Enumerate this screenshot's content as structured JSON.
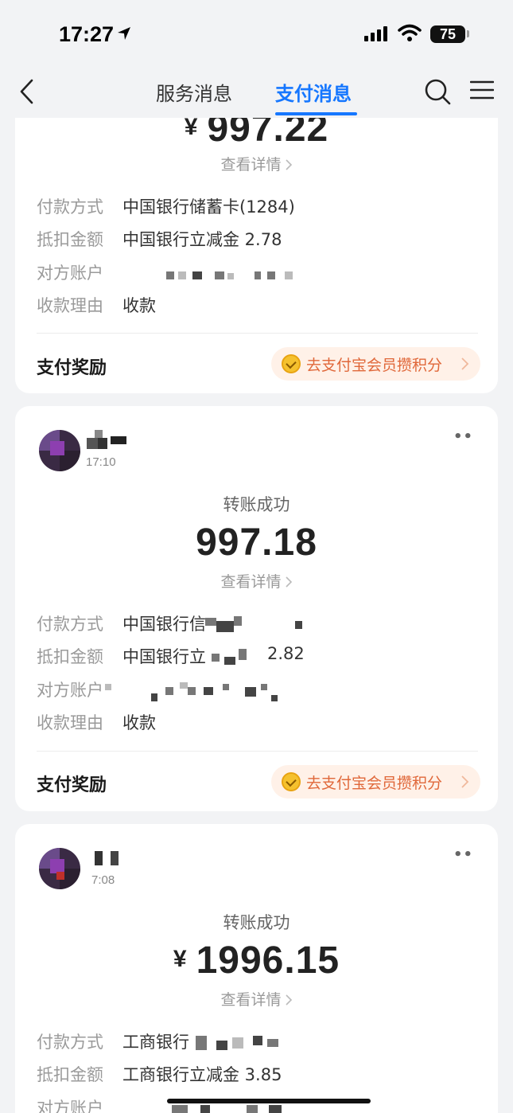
{
  "status_bar": {
    "time": "17:27",
    "battery": "75"
  },
  "nav": {
    "tabs": [
      {
        "label": "服务消息",
        "active": false
      },
      {
        "label": "支付消息",
        "active": true
      }
    ]
  },
  "cards": [
    {
      "currency": "¥",
      "amount": "997.22",
      "details_link": "查看详情",
      "rows": [
        {
          "label": "付款方式",
          "value": "中国银行储蓄卡(1284)"
        },
        {
          "label": "抵扣金额",
          "value": "中国银行立减金 2.78"
        },
        {
          "label": "对方账户",
          "value": ""
        },
        {
          "label": "收款理由",
          "value": "收款"
        }
      ],
      "reward_label": "支付奖励",
      "reward_button": "去支付宝会员攒积分"
    },
    {
      "time": "17:10",
      "status": "转账成功",
      "currency": "",
      "amount": "997.18",
      "details_link": "查看详情",
      "rows": [
        {
          "label": "付款方式",
          "value": "中国银行信"
        },
        {
          "label": "抵扣金额",
          "value": "中国银行立"
        },
        {
          "label": "对方账户",
          "value": ""
        },
        {
          "label": "收款理由",
          "value": "收款"
        }
      ],
      "rows_extra": {
        "deduct_suffix": "2.82"
      },
      "reward_label": "支付奖励",
      "reward_button": "去支付宝会员攒积分"
    },
    {
      "time": "7:08",
      "status": "转账成功",
      "currency": "¥",
      "amount": "1996.15",
      "details_link": "查看详情",
      "rows": [
        {
          "label": "付款方式",
          "value": "工商银行"
        },
        {
          "label": "抵扣金额",
          "value": "工商银行立减金 3.85"
        },
        {
          "label": "对方账户",
          "value": ""
        }
      ]
    }
  ],
  "icons": {
    "back": "chevron-left-icon",
    "search": "search-icon",
    "menu": "menu-icon",
    "more": "more-icon",
    "coin": "coin-icon"
  },
  "colors": {
    "accent": "#1677ff",
    "reward_text": "#e0683a",
    "reward_bg": "#fff1e8"
  }
}
